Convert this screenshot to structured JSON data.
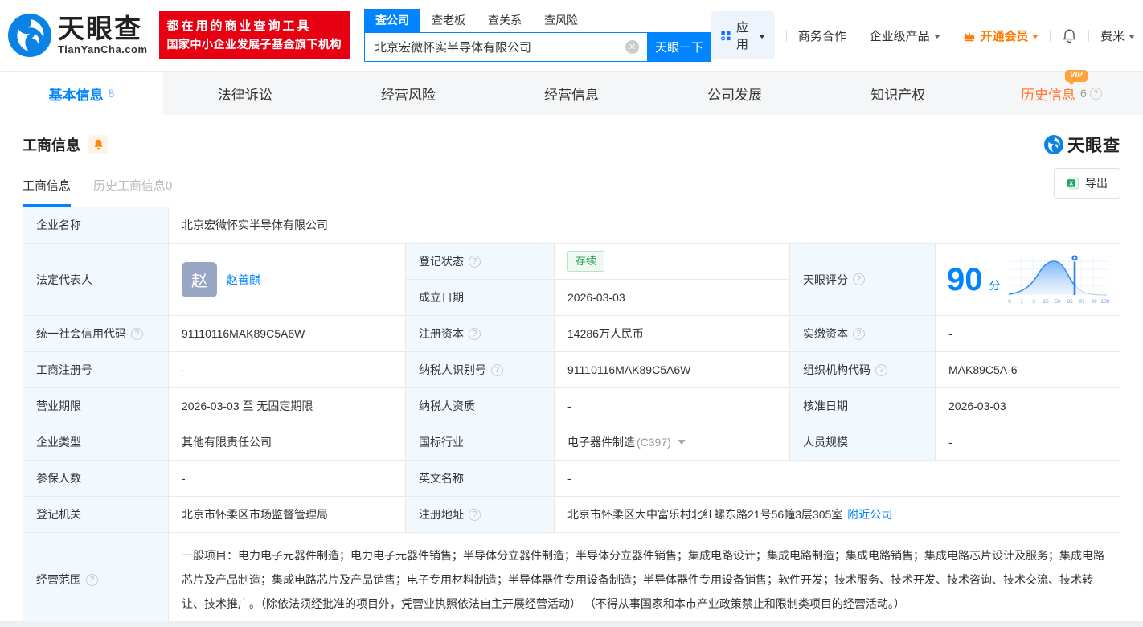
{
  "brand": {
    "name": "天眼查",
    "domain": "TianYanCha.com",
    "slogan_line1": "都在用的商业查询工具",
    "slogan_line2": "国家中小企业发展子基金旗下机构"
  },
  "search": {
    "tabs": [
      "查公司",
      "查老板",
      "查关系",
      "查风险"
    ],
    "value": "北京宏微怀实半导体有限公司",
    "button": "天眼一下"
  },
  "topnav": {
    "apps": "应用",
    "cooperation": "商务合作",
    "enterprise": "企业级产品",
    "vip": "开通会员",
    "user": "费米"
  },
  "tabs": {
    "basic": "基本信息",
    "basic_count": "8",
    "legal": "法律诉讼",
    "risk": "经营风险",
    "operation": "经营信息",
    "development": "公司发展",
    "ip": "知识产权",
    "history": "历史信息",
    "history_count": "6",
    "history_vip": "VIP"
  },
  "section": {
    "title": "工商信息",
    "subtab_current": "工商信息",
    "subtab_history": "历史工商信息0",
    "export": "导出",
    "watermark": "天眼查"
  },
  "table": {
    "company_name": {
      "label": "企业名称",
      "value": "北京宏微怀实半导体有限公司"
    },
    "legal_rep": {
      "label": "法定代表人",
      "avatar": "赵",
      "name": "赵善麒"
    },
    "reg_status": {
      "label": "登记状态",
      "value": "存续"
    },
    "establish_date": {
      "label": "成立日期",
      "value": "2026-03-03"
    },
    "score": {
      "label": "天眼评分",
      "value": "90",
      "unit": "分"
    },
    "credit_code": {
      "label": "统一社会信用代码",
      "value": "91110116MAK89C5A6W"
    },
    "reg_capital": {
      "label": "注册资本",
      "value": "14286万人民币"
    },
    "paid_capital": {
      "label": "实缴资本",
      "value": "-"
    },
    "reg_number": {
      "label": "工商注册号",
      "value": "-"
    },
    "taxpayer_id": {
      "label": "纳税人识别号",
      "value": "91110116MAK89C5A6W"
    },
    "org_code": {
      "label": "组织机构代码",
      "value": "MAK89C5A-6"
    },
    "business_term": {
      "label": "营业期限",
      "value": "2026-03-03 至 无固定期限"
    },
    "taxpayer_quality": {
      "label": "纳税人资质",
      "value": "-"
    },
    "approval_date": {
      "label": "核准日期",
      "value": "2026-03-03"
    },
    "company_type": {
      "label": "企业类型",
      "value": "其他有限责任公司"
    },
    "industry": {
      "label": "国标行业",
      "value": "电子器件制造",
      "code": "(C397)"
    },
    "staff_size": {
      "label": "人员规模",
      "value": "-"
    },
    "insured_count": {
      "label": "参保人数",
      "value": "-"
    },
    "english_name": {
      "label": "英文名称",
      "value": "-"
    },
    "reg_authority": {
      "label": "登记机关",
      "value": "北京市怀柔区市场监督管理局"
    },
    "reg_address": {
      "label": "注册地址",
      "value": "北京市怀柔区大中富乐村北红螺东路21号56幢3层305室",
      "link": "附近公司"
    },
    "business_scope": {
      "label": "经营范围",
      "value": "一般项目：电力电子元器件制造；电力电子元器件销售；半导体分立器件制造；半导体分立器件销售；集成电路设计；集成电路制造；集成电路销售；集成电路芯片设计及服务；集成电路芯片及产品制造；集成电路芯片及产品销售；电子专用材料制造；半导体器件专用设备制造；半导体器件专用设备销售；软件开发；技术服务、技术开发、技术咨询、技术交流、技术转让、技术推广。（除依法须经批准的项目外，凭营业执照依法自主开展经营活动） （不得从事国家和本市产业政策禁止和限制类项目的经营活动。）"
    }
  },
  "score_chart": {
    "type": "area",
    "marker_value": 90,
    "axis_labels": [
      "0",
      "1",
      "3",
      "15",
      "50",
      "85",
      "97",
      "99",
      "100"
    ]
  },
  "colors": {
    "primary": "#0084ff",
    "orange": "#ff7a00",
    "red": "#e60012",
    "green": "#2aa05a",
    "label_bg": "#f1f8fe"
  }
}
